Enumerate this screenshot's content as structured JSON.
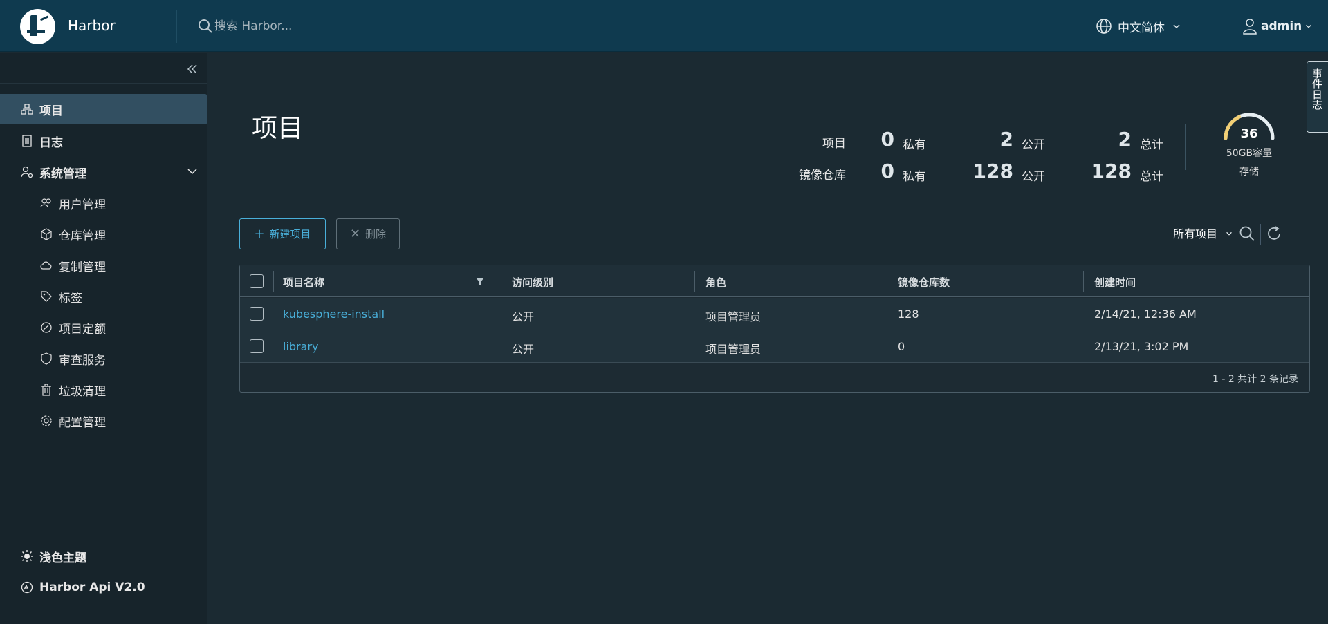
{
  "header": {
    "brand": "Harbor",
    "search_placeholder": "搜索 Harbor...",
    "language": "中文简体",
    "user": "admin"
  },
  "sidebar": {
    "items": [
      {
        "label": "项目",
        "icon": "project-icon",
        "active": true
      },
      {
        "label": "日志",
        "icon": "log-icon"
      },
      {
        "label": "系统管理",
        "icon": "admin-icon",
        "expanded": true
      }
    ],
    "sub_items": [
      {
        "label": "用户管理",
        "icon": "users-icon"
      },
      {
        "label": "仓库管理",
        "icon": "registry-icon"
      },
      {
        "label": "复制管理",
        "icon": "replication-icon"
      },
      {
        "label": "标签",
        "icon": "tag-icon"
      },
      {
        "label": "项目定额",
        "icon": "quota-icon"
      },
      {
        "label": "审查服务",
        "icon": "shield-icon"
      },
      {
        "label": "垃圾清理",
        "icon": "trash-icon"
      },
      {
        "label": "配置管理",
        "icon": "gear-icon"
      }
    ],
    "bottom": [
      {
        "label": "浅色主题",
        "icon": "sun-icon"
      },
      {
        "label": "Harbor Api V2.0",
        "icon": "api-icon"
      }
    ]
  },
  "main": {
    "title": "项目",
    "stats": {
      "projects_label": "项目",
      "repos_label": "镜像仓库",
      "private_label": "私有",
      "public_label": "公开",
      "total_label": "总计",
      "projects": {
        "private": "0",
        "public": "2",
        "total": "2"
      },
      "repos": {
        "private": "0",
        "public": "128",
        "total": "128"
      }
    },
    "storage": {
      "percent": "36",
      "capacity": "50GB容量",
      "label": "存储",
      "fill": 0.36
    },
    "side_tab": "事件日志",
    "toolbar": {
      "new_label": "新建项目",
      "delete_label": "删除",
      "filter_value": "所有项目"
    },
    "table": {
      "columns": [
        "项目名称",
        "访问级别",
        "角色",
        "镜像仓库数",
        "创建时间"
      ],
      "rows": [
        {
          "name": "kubesphere-install",
          "access": "公开",
          "role": "项目管理员",
          "repos": "128",
          "created": "2/14/21, 12:36 AM"
        },
        {
          "name": "library",
          "access": "公开",
          "role": "项目管理员",
          "repos": "0",
          "created": "2/13/21, 3:02 PM"
        }
      ],
      "footer": "1 - 2 共计 2 条记录"
    }
  },
  "colors": {
    "header_bg": "#0f3a4f",
    "sidebar_bg": "#17242b",
    "main_bg": "#1b2a32",
    "accent": "#49afd9",
    "gauge": "#f2cf74"
  }
}
